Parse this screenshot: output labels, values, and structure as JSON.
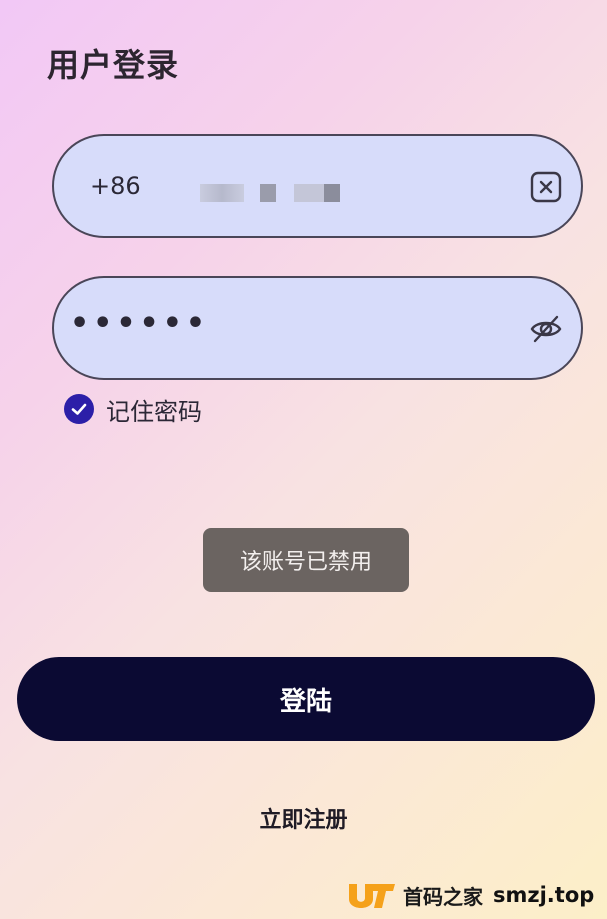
{
  "title": "用户登录",
  "phone_field": {
    "prefix": "+86",
    "value_masked": true,
    "clear_icon": "close-icon"
  },
  "password_field": {
    "value": "••••••",
    "toggle_icon": "eye-off-icon"
  },
  "remember": {
    "label": "记住密码",
    "checked": true,
    "check_color": "#2c1fa8"
  },
  "toast": {
    "message": "该账号已禁用"
  },
  "login_button": {
    "label": "登陆",
    "color": "#0b0a33"
  },
  "register_link": {
    "label": "立即注册"
  },
  "watermark": {
    "brand_cn": "首码之家",
    "brand_en": "smzj.top",
    "logo_color": "#f5a11a"
  }
}
